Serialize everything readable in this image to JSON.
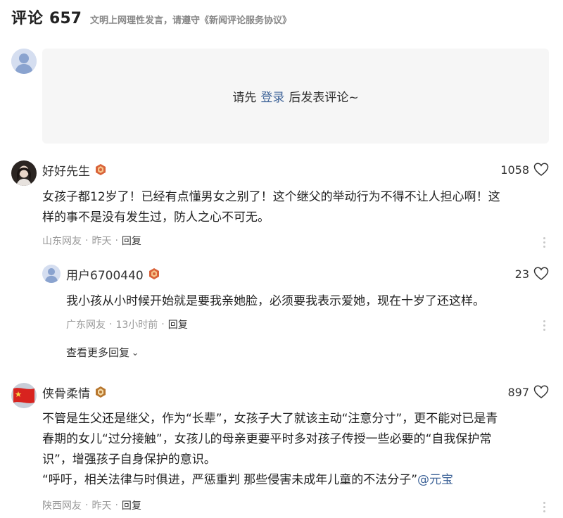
{
  "header": {
    "title": "评论",
    "count": "657",
    "notice": "文明上网理性发言，请遵守《新闻评论服务协议》"
  },
  "login_prompt": {
    "before": "请先",
    "link": "登录",
    "after": "后发表评论~"
  },
  "comments": [
    {
      "name": "好好先生",
      "likes": "1058",
      "text_lines": [
        "女孩子都12岁了！已经有点懂男女之别了！这个继父的举动行为不得不让人担心啊！这",
        "样的事不是没有发生过，防人之心不可无。"
      ],
      "location": "山东网友",
      "time": "昨天",
      "reply_label": "回复",
      "replies": [
        {
          "name": "用户6700440",
          "likes": "23",
          "text": "我小孩从小时候开始就是要我亲她脸，必须要我表示爱她，现在十岁了还这样。",
          "location": "广东网友",
          "time": "13小时前",
          "reply_label": "回复"
        }
      ],
      "more_replies_label": "查看更多回复"
    },
    {
      "name": "侠骨柔情",
      "likes": "897",
      "text_lines": [
        "不管是生父还是继父，作为“长辈”，女孩子大了就该主动“注意分寸”，更不能对已是青",
        "春期的女儿“过分接触”，女孩儿的母亲更要平时多对孩子传授一些必要的“自我保护常",
        "识”，增强孩子自身保护的意识。"
      ],
      "quote_line": "“呼吁，相关法律与时俱进，严惩重判 那些侵害未成年儿童的不法分子”",
      "mention": "@元宝",
      "location": "陕西网友",
      "time": "昨天",
      "reply_label": "回复"
    }
  ],
  "separator": "·",
  "colors": {
    "link": "#406599",
    "muted": "#999999",
    "box_bg": "#f6f6f6"
  }
}
